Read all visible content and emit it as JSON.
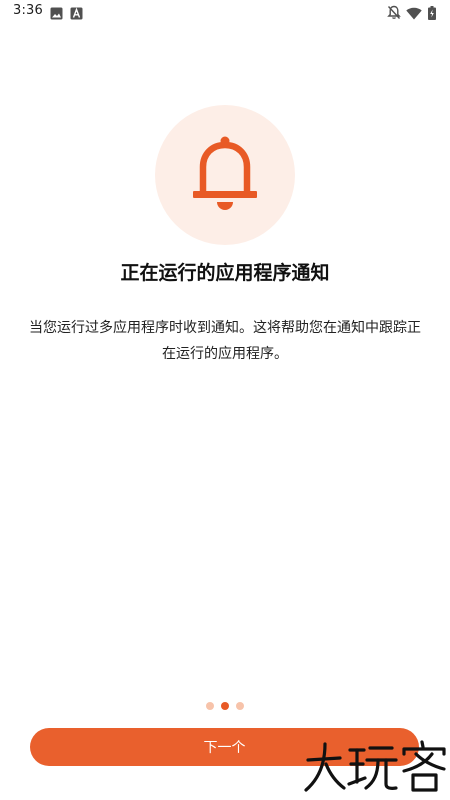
{
  "status_bar": {
    "time": "3:36",
    "left_icons": [
      "image-icon",
      "a-letter-icon"
    ],
    "right_icons": [
      "notifications-off-icon",
      "wifi-icon",
      "battery-charging-icon"
    ]
  },
  "onboarding": {
    "icon": "bell-icon",
    "title": "正在运行的应用程序通知",
    "description": "当您运行过多应用程序时收到通知。这将帮助您在通知中跟踪正在运行的应用程序。",
    "pager": {
      "total": 3,
      "current": 2
    },
    "next_button_label": "下一个"
  },
  "watermark": {
    "text": "大玩客"
  },
  "colors": {
    "accent": "#e9602d",
    "accent_light": "#fdeee7",
    "dot_inactive": "#f7c3aa"
  }
}
